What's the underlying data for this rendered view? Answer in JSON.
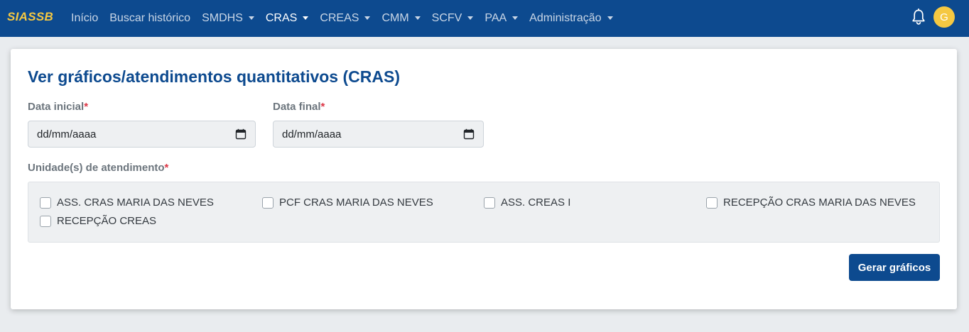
{
  "navbar": {
    "brand": "SIASSB",
    "items": [
      {
        "label": "Início",
        "dropdown": false,
        "active": false
      },
      {
        "label": "Buscar histórico",
        "dropdown": false,
        "active": false
      },
      {
        "label": "SMDHS",
        "dropdown": true,
        "active": false
      },
      {
        "label": "CRAS",
        "dropdown": true,
        "active": true
      },
      {
        "label": "CREAS",
        "dropdown": true,
        "active": false
      },
      {
        "label": "CMM",
        "dropdown": true,
        "active": false
      },
      {
        "label": "SCFV",
        "dropdown": true,
        "active": false
      },
      {
        "label": "PAA",
        "dropdown": true,
        "active": false
      },
      {
        "label": "Administração",
        "dropdown": true,
        "active": false
      }
    ],
    "notification_icon": "bell-icon",
    "avatar_initial": "G"
  },
  "page": {
    "title": "Ver gráficos/atendimentos quantitativos (CRAS)",
    "required_mark": "*",
    "start_date": {
      "label": "Data inicial",
      "placeholder": "dd/mm/aaaa"
    },
    "end_date": {
      "label": "Data final",
      "placeholder": "dd/mm/aaaa"
    },
    "units": {
      "label": "Unidade(s) de atendimento",
      "options": [
        {
          "label": "ASS. CRAS MARIA DAS NEVES",
          "checked": false
        },
        {
          "label": "PCF CRAS MARIA DAS NEVES",
          "checked": false
        },
        {
          "label": "ASS. CREAS I",
          "checked": false
        },
        {
          "label": "RECEPÇÃO CRAS MARIA DAS NEVES",
          "checked": false
        },
        {
          "label": "RECEPÇÃO CREAS",
          "checked": false
        }
      ]
    },
    "submit_label": "Gerar gráficos"
  },
  "colors": {
    "navbar_bg": "#0d4a8f",
    "brand": "#f5c842",
    "primary": "#0d4a8f",
    "required": "#dc3545"
  }
}
